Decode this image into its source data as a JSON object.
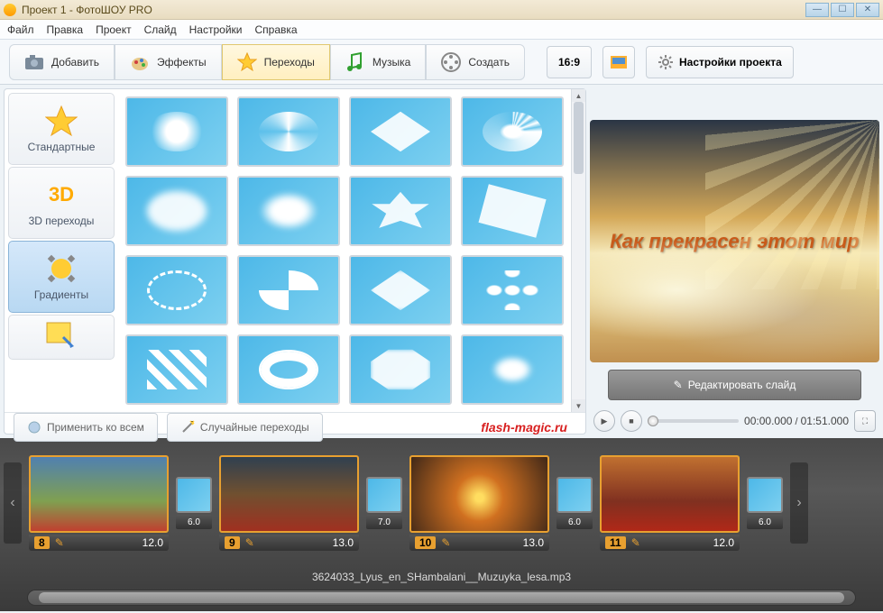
{
  "window": {
    "title": "Проект 1 - ФотоШОУ PRO"
  },
  "menu": {
    "items": [
      "Файл",
      "Правка",
      "Проект",
      "Слайд",
      "Настройки",
      "Справка"
    ]
  },
  "tabs": {
    "add": "Добавить",
    "effects": "Эффекты",
    "transitions": "Переходы",
    "music": "Музыка",
    "create": "Создать",
    "active_index": 2
  },
  "toolbar_right": {
    "aspect": "16:9",
    "project_settings": "Настройки проекта"
  },
  "categories": {
    "standard": "Стандартные",
    "three_d": "3D переходы",
    "gradients": "Градиенты",
    "three_d_label": "3D",
    "active_index": 2
  },
  "footer_buttons": {
    "apply_all": "Применить ко всем",
    "random": "Случайные переходы"
  },
  "watermark": "flash-magic.ru",
  "preview": {
    "text": "Как  прекрасен этот мир",
    "edit_slide": "Редактировать слайд",
    "time_current": "00:00.000",
    "time_total": "01:51.000"
  },
  "timeline": {
    "slides": [
      {
        "num": "8",
        "dur": "12.0",
        "trans_dur": "6.0"
      },
      {
        "num": "9",
        "dur": "13.0",
        "trans_dur": "7.0"
      },
      {
        "num": "10",
        "dur": "13.0",
        "trans_dur": "6.0"
      },
      {
        "num": "11",
        "dur": "12.0",
        "trans_dur": "6.0"
      },
      {
        "num": "",
        "dur": "",
        "trans_dur": "6.0"
      }
    ],
    "audio": "3624033_Lyus_en_SHambalani__Muzuyka_lesa.mp3"
  }
}
